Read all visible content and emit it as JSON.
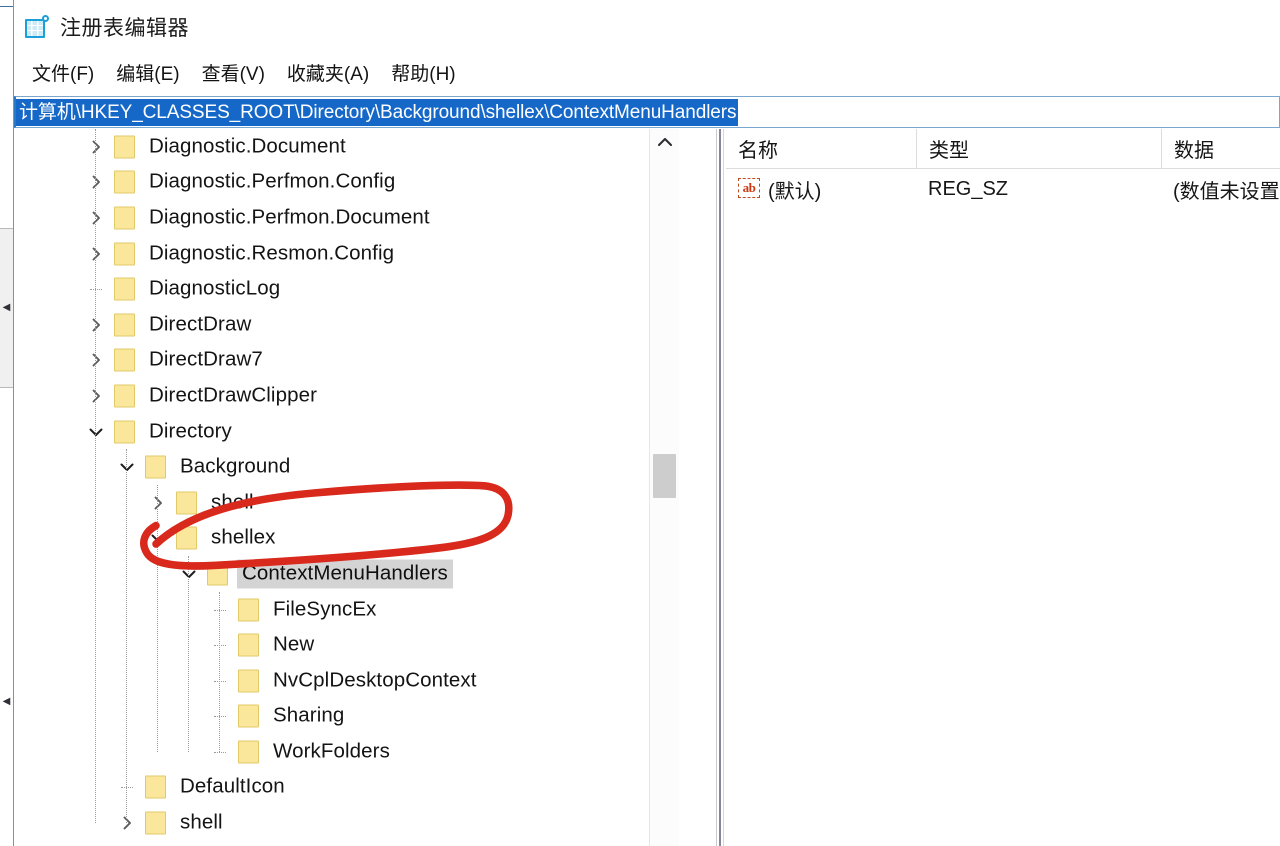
{
  "window": {
    "title": "注册表编辑器",
    "icon": "registry-editor-icon"
  },
  "menubar": {
    "items": [
      {
        "label": "文件(F)",
        "name": "menu-file"
      },
      {
        "label": "编辑(E)",
        "name": "menu-edit"
      },
      {
        "label": "查看(V)",
        "name": "menu-view"
      },
      {
        "label": "收藏夹(A)",
        "name": "menu-favorites"
      },
      {
        "label": "帮助(H)",
        "name": "menu-help"
      }
    ]
  },
  "address": {
    "value": "计算机\\HKEY_CLASSES_ROOT\\Directory\\Background\\shellex\\ContextMenuHandlers",
    "selected": true,
    "selection_color": "#1668c8"
  },
  "tree": {
    "nodes": [
      {
        "label": "Diagnostic.Document",
        "depth": 1,
        "twisty": "collapsed",
        "selected": false
      },
      {
        "label": "Diagnostic.Perfmon.Config",
        "depth": 1,
        "twisty": "collapsed",
        "selected": false
      },
      {
        "label": "Diagnostic.Perfmon.Document",
        "depth": 1,
        "twisty": "collapsed",
        "selected": false
      },
      {
        "label": "Diagnostic.Resmon.Config",
        "depth": 1,
        "twisty": "collapsed",
        "selected": false
      },
      {
        "label": "DiagnosticLog",
        "depth": 1,
        "twisty": "none",
        "selected": false
      },
      {
        "label": "DirectDraw",
        "depth": 1,
        "twisty": "collapsed",
        "selected": false
      },
      {
        "label": "DirectDraw7",
        "depth": 1,
        "twisty": "collapsed",
        "selected": false
      },
      {
        "label": "DirectDrawClipper",
        "depth": 1,
        "twisty": "collapsed",
        "selected": false
      },
      {
        "label": "Directory",
        "depth": 1,
        "twisty": "expanded",
        "selected": false
      },
      {
        "label": "Background",
        "depth": 2,
        "twisty": "expanded",
        "selected": false
      },
      {
        "label": "shell",
        "depth": 3,
        "twisty": "collapsed",
        "selected": false
      },
      {
        "label": "shellex",
        "depth": 3,
        "twisty": "expanded",
        "selected": false
      },
      {
        "label": "ContextMenuHandlers",
        "depth": 4,
        "twisty": "expanded",
        "selected": true
      },
      {
        "label": "FileSyncEx",
        "depth": 5,
        "twisty": "none",
        "selected": false
      },
      {
        "label": "New",
        "depth": 5,
        "twisty": "none",
        "selected": false
      },
      {
        "label": "NvCplDesktopContext",
        "depth": 5,
        "twisty": "none",
        "selected": false
      },
      {
        "label": "Sharing",
        "depth": 5,
        "twisty": "none",
        "selected": false
      },
      {
        "label": "WorkFolders",
        "depth": 5,
        "twisty": "none",
        "selected": false
      },
      {
        "label": "DefaultIcon",
        "depth": 2,
        "twisty": "none",
        "selected": false
      },
      {
        "label": "shell",
        "depth": 2,
        "twisty": "collapsed",
        "selected": false
      }
    ],
    "selection_color": "#d4d4d4",
    "folder_color": "#fbe79b"
  },
  "list": {
    "columns": [
      {
        "label": "名称",
        "name": "column-name"
      },
      {
        "label": "类型",
        "name": "column-type"
      },
      {
        "label": "数据",
        "name": "column-data"
      }
    ],
    "rows": [
      {
        "icon": "string-value-icon",
        "name": "(默认)",
        "type": "REG_SZ",
        "data": "(数值未设置"
      }
    ]
  },
  "annotation": {
    "kind": "hand-drawn-red-ellipse",
    "color": "#d8291c",
    "targets": "ContextMenuHandlers"
  }
}
